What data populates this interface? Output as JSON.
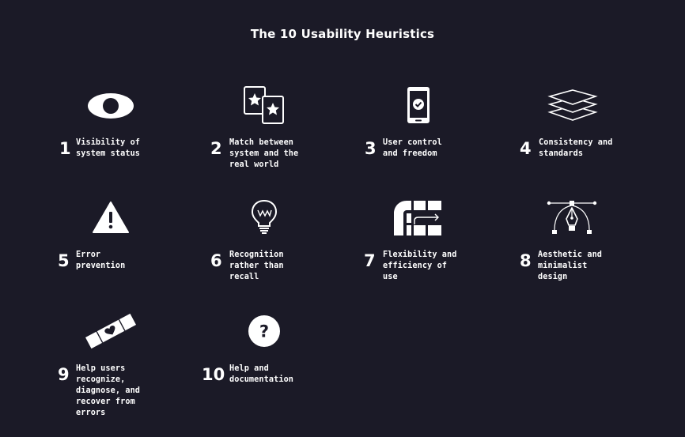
{
  "title": "The 10 Usability Heuristics",
  "heuristics": [
    {
      "number": "1",
      "label": "Visibility of\nsystem status",
      "icon": "eye-icon"
    },
    {
      "number": "2",
      "label": "Match between\nsystem and the\nreal world",
      "icon": "star-cards-icon"
    },
    {
      "number": "3",
      "label": "User control\nand freedom",
      "icon": "phone-check-icon"
    },
    {
      "number": "4",
      "label": "Consistency and\nstandards",
      "icon": "layers-icon"
    },
    {
      "number": "5",
      "label": "Error\nprevention",
      "icon": "warning-icon"
    },
    {
      "number": "6",
      "label": "Recognition\nrather than\nrecall",
      "icon": "lightbulb-icon"
    },
    {
      "number": "7",
      "label": "Flexibility and\nefficiency of\nuse",
      "icon": "shortcut-icon"
    },
    {
      "number": "8",
      "label": "Aesthetic and\nminimalist\ndesign",
      "icon": "pen-tool-icon"
    },
    {
      "number": "9",
      "label": "Help users\nrecognize,\ndiagnose, and\nrecover from\nerrors",
      "icon": "bandage-icon"
    },
    {
      "number": "10",
      "label": "Help and\ndocumentation",
      "icon": "question-icon"
    }
  ],
  "colors": {
    "background": "#1b1a27",
    "foreground": "#ffffff"
  }
}
